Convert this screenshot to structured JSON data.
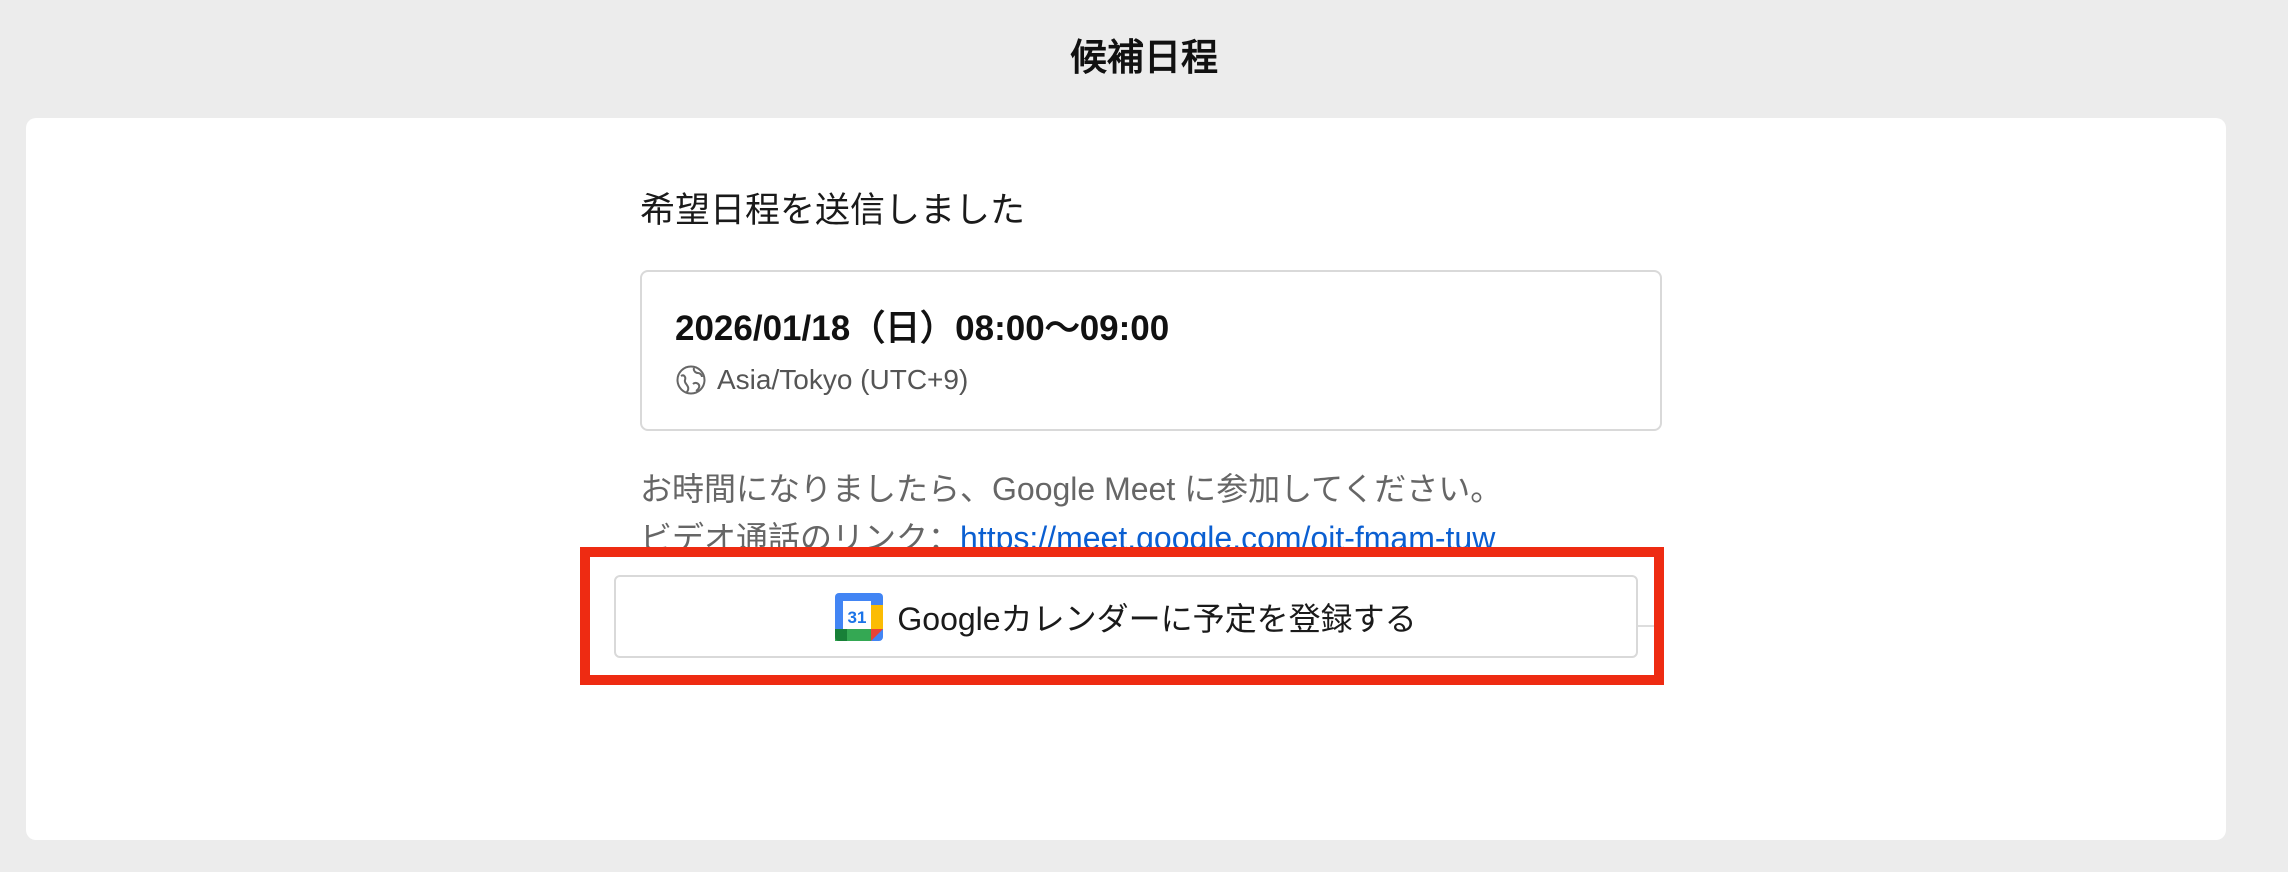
{
  "page": {
    "title": "候補日程"
  },
  "confirmation": {
    "heading": "希望日程を送信しました",
    "slot": {
      "datetime": "2026/01/18（日）08:00〜09:00",
      "timezone": "Asia/Tokyo (UTC+9)",
      "timezone_icon": "globe-icon"
    },
    "message_line1": "お時間になりましたら、Google Meet に参加してください。",
    "message_line2_prefix": "ビデオ通話のリンク：",
    "meet_link": "https://meet.google.com/oit-fmam-tuw"
  },
  "gcal_button": {
    "label": "Googleカレンダーに予定を登録する",
    "icon": "google-calendar-icon",
    "icon_day": "31"
  },
  "colors": {
    "background": "#ececec",
    "card": "#ffffff",
    "link": "#0b5fd1",
    "highlight": "#ee2b12"
  }
}
